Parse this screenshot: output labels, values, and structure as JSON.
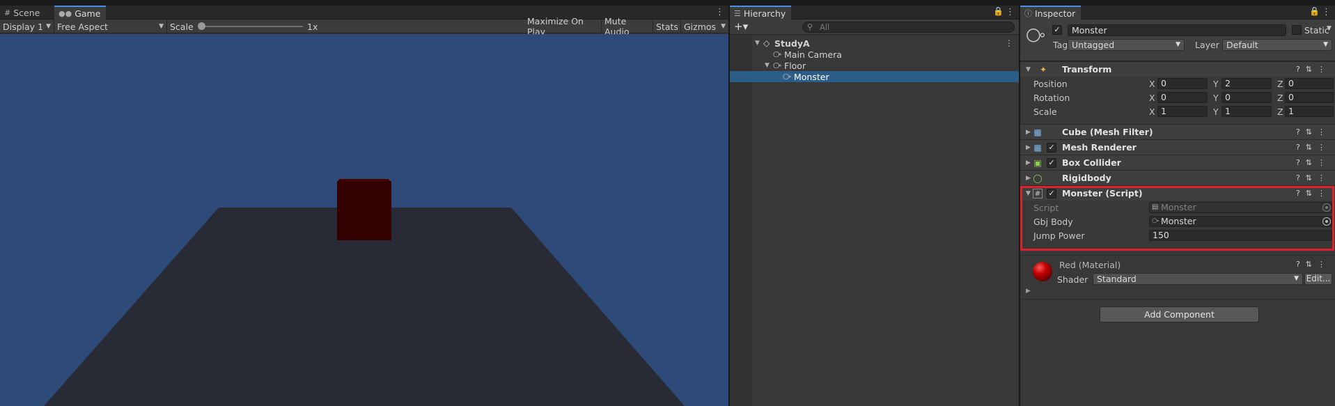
{
  "game_panel": {
    "tabs": [
      {
        "label": "Scene",
        "icon": "grid-icon"
      },
      {
        "label": "Game",
        "icon": "gamepad-icon"
      }
    ],
    "display": "Display 1",
    "aspect": "Free Aspect",
    "scale_label": "Scale",
    "scale_value": "1x",
    "scale_slider_fraction": 0.0,
    "maximize": "Maximize On Play",
    "mute": "Mute Audio",
    "stats": "Stats",
    "gizmos": "Gizmos",
    "colors": {
      "sky": "#2e4a78",
      "floor": "#282b36",
      "cube": "#340000"
    }
  },
  "hierarchy": {
    "title": "Hierarchy",
    "search_placeholder": "All",
    "items": [
      {
        "label": "StudyA",
        "depth": 0,
        "expanded": true,
        "selected": false,
        "icon": "unity-scene-icon"
      },
      {
        "label": "Main Camera",
        "depth": 1,
        "selected": false,
        "icon": "cube-icon"
      },
      {
        "label": "Floor",
        "depth": 1,
        "expanded": true,
        "selected": false,
        "icon": "cube-icon"
      },
      {
        "label": "Monster",
        "depth": 2,
        "selected": true,
        "icon": "cube-icon"
      }
    ]
  },
  "inspector": {
    "title": "Inspector",
    "object_name": "Monster",
    "static_label": "Static",
    "tag_label": "Tag",
    "tag_value": "Untagged",
    "layer_label": "Layer",
    "layer_value": "Default",
    "transform": {
      "title": "Transform",
      "rows": [
        {
          "label": "Position",
          "x": "0",
          "y": "2",
          "z": "0"
        },
        {
          "label": "Rotation",
          "x": "0",
          "y": "0",
          "z": "0"
        },
        {
          "label": "Scale",
          "x": "1",
          "y": "1",
          "z": "1"
        }
      ]
    },
    "components": [
      {
        "name": "Cube (Mesh Filter)",
        "icon": "mesh-filter-icon",
        "checkbox": false
      },
      {
        "name": "Mesh Renderer",
        "icon": "mesh-renderer-icon",
        "checkbox": true
      },
      {
        "name": "Box Collider",
        "icon": "box-collider-icon",
        "checkbox": true
      },
      {
        "name": "Rigidbody",
        "icon": "rigidbody-icon",
        "checkbox": false
      }
    ],
    "script_component": {
      "name": "Monster (Script)",
      "script_label": "Script",
      "script_value": "Monster",
      "gbj_label": "Gbj Body",
      "gbj_value": "Monster",
      "jump_label": "Jump Power",
      "jump_value": "150"
    },
    "material": {
      "name": "Red (Material)",
      "shader_label": "Shader",
      "shader_value": "Standard",
      "edit_label": "Edit..."
    },
    "add_component": "Add Component"
  }
}
